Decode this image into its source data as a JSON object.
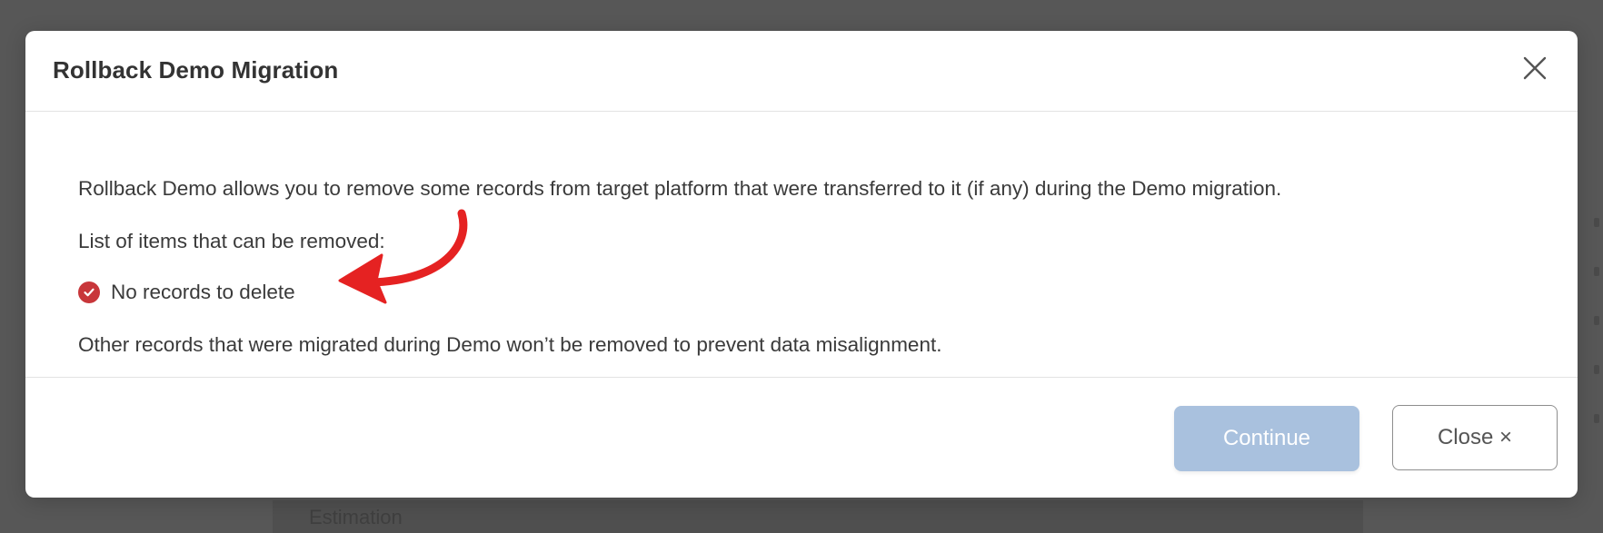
{
  "dialog": {
    "title": "Rollback Demo Migration",
    "description": "Rollback Demo allows you to remove some records from target platform that were transferred to it (if any) during the Demo migration.",
    "list_heading": "List of items that can be removed:",
    "item_status": "No records to delete",
    "footnote": "Other records that were migrated during Demo won’t be removed to prevent data misalignment.",
    "continue_label": "Continue",
    "close_label": "Close ×"
  },
  "background": {
    "partial_text": "Estimation"
  },
  "colors": {
    "overlay": "#575757",
    "check_icon": "#c8363a",
    "annotation_arrow": "#e52222",
    "continue_disabled": "#a9c1de"
  },
  "icons": {
    "close": "close-icon",
    "status": "check-circle-icon",
    "annotation": "curved-arrow-icon"
  }
}
